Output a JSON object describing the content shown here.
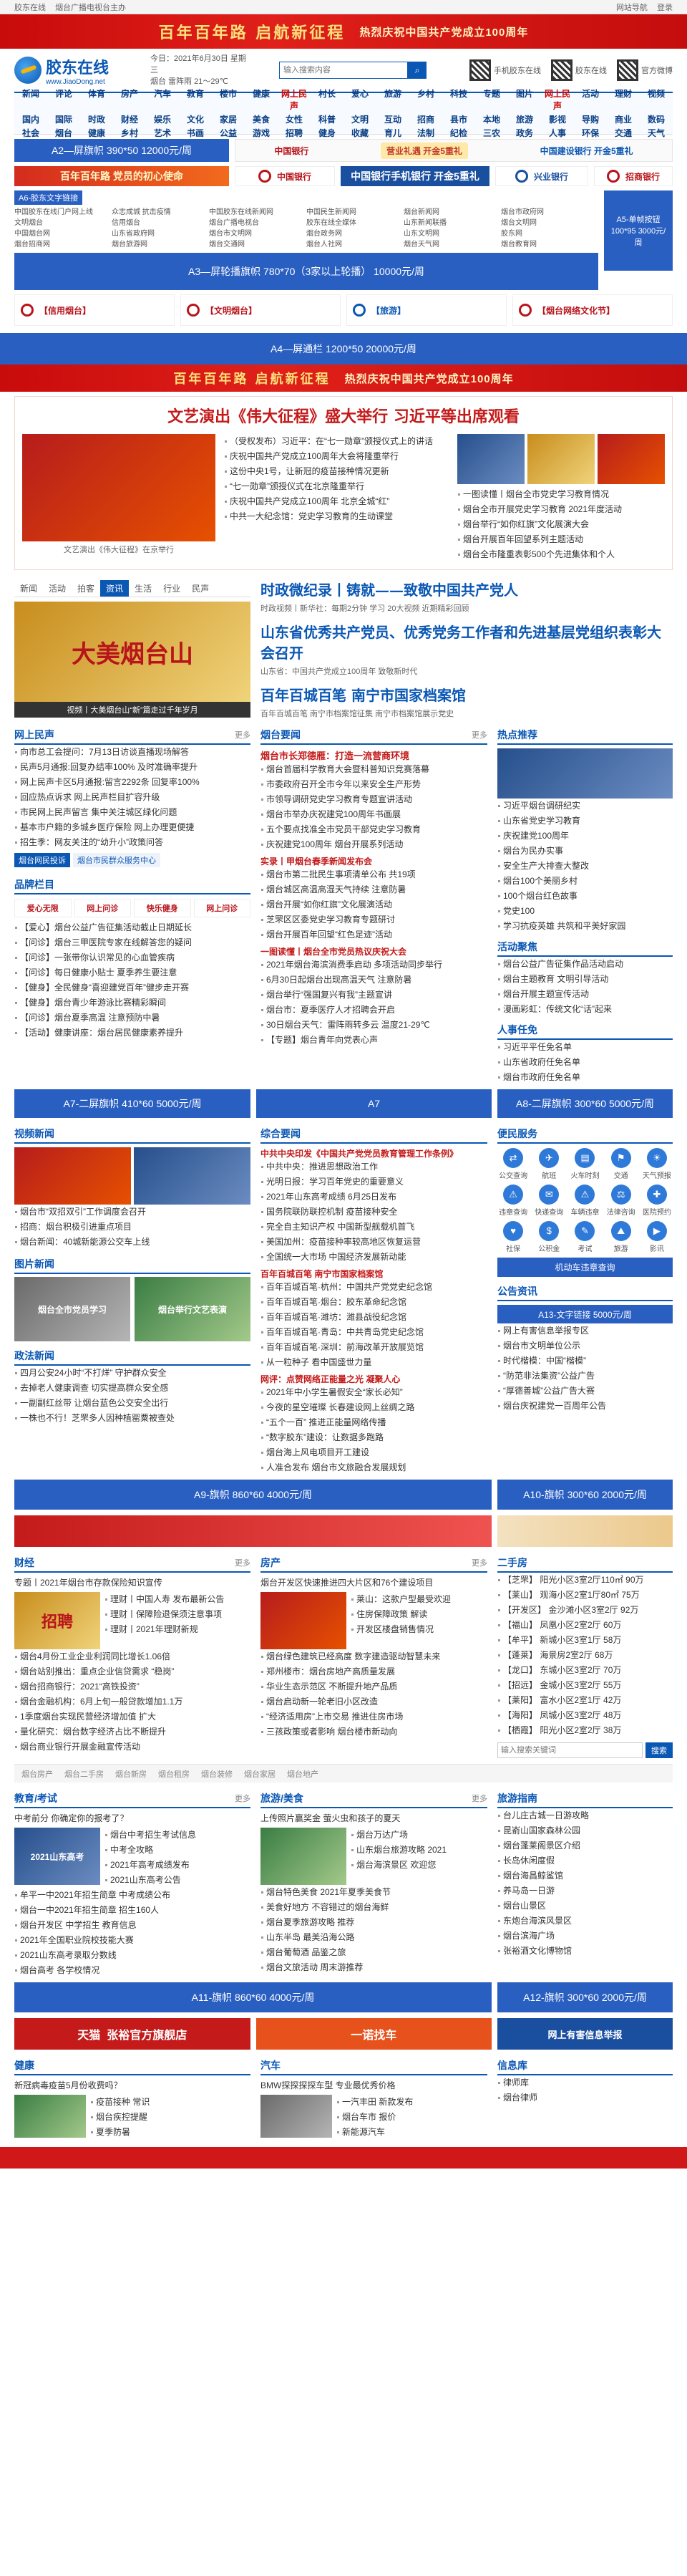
{
  "topbar": {
    "left": [
      "胶东在线",
      "烟台广播电视台主办"
    ],
    "right": [
      "网站导航",
      "登录"
    ]
  },
  "banner": {
    "main": "百年百年路 启航新征程",
    "sub": "热烈庆祝中国共产党成立100周年"
  },
  "header": {
    "logo_name": "胶东在线",
    "logo_url": "www.JiaoDong.net",
    "date": "今日：2021年6月30日 星期三",
    "weather": "烟台 雷阵雨 21～29℃",
    "search_placeholder": "输入搜索内容",
    "qr": [
      "手机胶东在线",
      "胶东在线",
      "官方微博"
    ]
  },
  "nav": [
    "新闻",
    "评论",
    "体育",
    "房产",
    "汽车",
    "教育",
    "楼市",
    "健康",
    "网上民声",
    "村长",
    "爱心",
    "旅游",
    "乡村",
    "科技",
    "专题",
    "图片",
    "网上民声",
    "活动",
    "理财",
    "视频",
    "国内",
    "国际",
    "时政",
    "财经",
    "娱乐",
    "文化",
    "家居",
    "美食",
    "女性",
    "科普",
    "文明",
    "互动",
    "招商",
    "县市",
    "本地",
    "旅游",
    "影视",
    "导购",
    "商业",
    "数码",
    "社会",
    "烟台",
    "健康",
    "乡村",
    "艺术",
    "书画",
    "公益",
    "游戏",
    "招聘",
    "健身",
    "收藏",
    "育儿",
    "法制",
    "纪检",
    "三农",
    "政务",
    "人事",
    "环保",
    "交通",
    "天气"
  ],
  "ads": {
    "a2": "A2—屏旗帜    390*50    12000元/周",
    "a3": "A3—屏轮播旗帜  780*70（3家以上轮播） 10000元/周",
    "a4": "A4—屏通栏    1200*50    20000元/周",
    "a5": "A5-单帧按钮 100*95 3000元/周",
    "a6": "A6-胶东文字链接",
    "a7_left": "A7-二屏旗帜  410*60  5000元/周",
    "a7_mid": "A7",
    "a8": "A8-二屏旗帜  300*60  5000元/周",
    "a9": "A9-旗帜  860*60  4000元/周",
    "a10": "A10-旗帜  300*60  2000元/周",
    "a11": "A11-旗帜  860*60  4000元/周",
    "a12": "A12-旗帜  300*60  2000元/周",
    "a13": "A13-文字链接  5000元/周",
    "bank1": "中国银行",
    "bank2": "中国银行手机银行 开金5重礼",
    "red_strip_1": "百年百年路 党员的初心使命",
    "red_strip_2": "热烈庆祝中国共产党成立100周年",
    "bank_promo": "中国建设银行 开金5重礼",
    "gift": "营业礼遇 开金5重礼",
    "cib": "兴业银行",
    "cmb": "招商银行",
    "yantai_1": "【信用烟台】",
    "yantai_2": "【文明烟台】",
    "yantai_3": "【旅游】",
    "yantai_4": "【烟台网络文化节】"
  },
  "text_links": [
    "中国胶东在线门户网上线",
    "众志成城 抗击疫情",
    "中国胶东在线新闻网",
    "中国民生新闻网",
    "烟台新闻网",
    "烟台市政府网",
    "文明烟台",
    "信用烟台",
    "烟台广播电视台",
    "胶东在线全媒体",
    "山东新闻联播",
    "烟台文明网",
    "中国烟台网",
    "山东省政府网",
    "烟台市文明网",
    "烟台政务网",
    "山东文明网",
    "胶东网",
    "烟台招商网",
    "烟台旅游网",
    "烟台交通网",
    "烟台人社网",
    "烟台天气网",
    "烟台教育网"
  ],
  "feature": {
    "headline": "文艺演出《伟大征程》盛大举行 习近平等出席观看",
    "items": [
      "（受权发布）习近平：在“七一勋章”颁授仪式上的讲话",
      "庆祝中国共产党成立100周年大会将隆重举行",
      "这份中央1号，让新冠的疫苗接种情况更新",
      "“七一勋章”颁授仪式在北京隆重举行",
      "庆祝中国共产党成立100周年 北京全城“红”",
      "中共一大纪念馆：党史学习教育的生动课堂"
    ],
    "right_items": [
      "一图读懂丨烟台全市党史学习教育情况",
      "烟台全市开展党史学习教育 2021年度活动",
      "烟台举行“如你红旗”文化展演大会",
      "烟台开展百年回望系列主题活动",
      "烟台全市隆重表彰500个先进集体和个人"
    ],
    "img_caption": "文艺演出《伟大征程》在京举行"
  },
  "section_tabs": [
    "新闻",
    "活动",
    "拍客",
    "资讯",
    "生活",
    "行业",
    "民声"
  ],
  "fancy_title": "大美烟台山",
  "fancy_caption": "视频丨大美烟台山“新”篇走过千年岁月",
  "politics": {
    "title": "时政微纪录丨铸就——致敬中国共产党人",
    "sub": "时政视频丨新华社：每期2分钟 学习 20大视频 近期精彩回顾",
    "headline2": "山东省优秀共产党员、优秀党务工作者和先进基层党组织表彰大会召开",
    "sub2": "山东省：中国共产党成立100周年 致敬新时代",
    "headline3": "百年百城百笔  南宁市国家档案馆",
    "sub3": "百年百城百笔 南宁市档案馆征集 南宁市档案馆展示党史"
  },
  "minsheng": {
    "title": "网上民声",
    "more": "更多",
    "items": [
      "向市总工会提问：7月13日访谈直播现场解答",
      "民声5月通报:回复办结率100% 及时准确率提升",
      "网上民声卡区5月通报:留言2292条 回复率100%",
      "回应热点诉求 网上民声栏目扩容升级",
      "市民网上民声留言 集中关注城区绿化问题",
      "基本市户籍的多城乡医疗保险 网上办理更便捷",
      "招生季：网友关注的“幼升小”政策问答"
    ],
    "tabs": [
      "烟台网民投诉",
      "烟台市民群众服务中心"
    ]
  },
  "brand": {
    "title": "品牌栏目",
    "logos": [
      "爱心无限",
      "网上问诊",
      "快乐健身",
      "网上问诊"
    ],
    "items": [
      "【爱心】烟台公益广告征集活动截止日期延长",
      "【问诊】烟台三甲医院专家在线解答您的疑问",
      "【问诊】一张带你认识常见的心血管疾病",
      "【问诊】每日健康小贴士 夏季养生要注意",
      "【健身】全民健身“喜迎建党百年”健步走开赛",
      "【健身】烟台青少年游泳比赛精彩瞬间",
      "【问诊】烟台夏季高温 注意预防中暑",
      "【活动】健康讲座：烟台居民健康素养提升"
    ]
  },
  "yantai_news": {
    "title": "烟台要闻",
    "more": "更多",
    "top": "烟台市长郑德雁：打造一流营商环境",
    "list_a": [
      "烟台首届科学教育大会暨科普知识竞赛落幕",
      "市委政府召开全市今年以来安全生产形势",
      "市领导调研党史学习教育专题宣讲活动",
      "烟台市举办庆祝建党100周年书画展",
      "五个要点找准全市党员干部党史学习教育",
      "庆祝建党100周年 烟台开展系列活动"
    ],
    "group1_title": "实录丨甲烟台春季新闻发布会",
    "list_b": [
      "烟台市第二批民生事项清单公布 共19项",
      "烟台城区高温高湿天气持续 注意防暑",
      "烟台开展“如你红旗”文化展演活动",
      "芝罘区区委党史学习教育专题研讨",
      "烟台开展百年回望“红色足迹”活动"
    ],
    "group2_title": "一图读懂丨烟台全市党员热议庆祝大会",
    "list_c": [
      "2021年烟台海滨消费季启动 多项活动同步举行",
      "6月30日起烟台出现高温天气 注意防暑",
      "烟台举行“强国复兴有我”主题宣讲",
      "烟台市：夏季医疗人才招聘会开启",
      "30日烟台天气：雷阵雨转多云 温度21-29℃",
      "【专题】烟台青年向党表心声"
    ]
  },
  "hot": {
    "title": "热点推荐",
    "items": [
      "习近平烟台调研纪实",
      "山东省党史学习教育",
      "庆祝建党100周年",
      "烟台为民办实事",
      "安全生产大排查大整改",
      "烟台100个美丽乡村",
      "100个烟台红色故事",
      "党史100",
      "学习抗疫英雄 共筑和平美好家园"
    ],
    "activity_title": "活动聚焦",
    "activity": [
      "烟台公益广告征集作品活动启动",
      "烟台主题教育 文明引导活动",
      "烟台开展主题宣传活动",
      "漫画彩虹：传统文化“话”起来"
    ],
    "people_title": "人事任免",
    "people": [
      "习近平平任免名单",
      "山东省政府任免名单",
      "烟台市政府任免名单"
    ]
  },
  "video": {
    "title": "视频新闻",
    "items": [
      "烟台市“双招双引”工作调度会召开",
      "招商：烟台积极引进重点项目",
      "烟台新闻：40城新能源公交车上线"
    ]
  },
  "pictures": {
    "title": "图片新闻",
    "caption1": "烟台全市党员学习",
    "caption2": "烟台举行文艺表演"
  },
  "politics_news": {
    "title": "政法新闻",
    "items": [
      "四月公安24小时“不打烊” 守护群众安全",
      "去掉老人健康调查 切实提高群众安全感",
      "一副副红丝带 让烟台蓝色公交安全出行",
      "一株也不行！芝罘多人因种植罂粟被查处"
    ]
  },
  "general": {
    "title": "综合要闻",
    "top": "中共中央印发《中国共产党党员教育管理工作条例》",
    "items": [
      "中共中央：推进思想政治工作",
      "光明日报：学习百年党史的重要意义",
      "2021年山东高考成绩 6月25日发布",
      "国务院联防联控机制 疫苗接种安全",
      "完全自主知识产权 中国新型舰载机首飞",
      "美国加州：疫苗接种率较高地区恢复运营",
      "全国统一大市场 中国经济发展新动能"
    ],
    "sub_title": "百年百城百笔 南宁市国家档案馆",
    "items2": [
      "百年百城百笔·杭州：中国共产党党史纪念馆",
      "百年百城百笔·烟台：胶东革命纪念馆",
      "百年百城百笔·潍坊：潍县战役纪念馆",
      "百年百城百笔·青岛：中共青岛党史纪念馆",
      "百年百城百笔·深圳：前海改革开放展览馆",
      "从一粒种子 看中国盛世力量"
    ],
    "sub2_title": "网评：点赞网络正能量之光 凝聚人心",
    "items3": [
      "2021年中小学生暑假安全“家长必知”",
      "今夜的星空璀璨 长春建设网上丝绸之路",
      "“五个一百” 推进正能量网络传播",
      "“数字胶东”建设：让数据多跑路",
      "烟台海上风电项目开工建设",
      "人准合发布 烟台市文旅融合发展规划"
    ]
  },
  "service": {
    "title": "便民服务",
    "items": [
      "公交查询",
      "航班",
      "火车时刻",
      "交通",
      "天气预报",
      "违章查询",
      "快递查询",
      "车辆违章",
      "法律咨询",
      "医院预约",
      "社保",
      "公积金",
      "考试",
      "旅游",
      "影讯"
    ],
    "car_btn": "机动车违章查询"
  },
  "notice": {
    "title": "公告资讯",
    "items": [
      "网上有害信息举报专区",
      "烟台市文明单位公示",
      "时代楷模：中国“楷模”",
      "“防范非法集资”公益广告",
      "“厚德善城”公益广告大赛",
      "烟台庆祝建党一百周年公告"
    ]
  },
  "finance": {
    "title": "财经",
    "more": "更多",
    "special": "专题丨2021年烟台市存款保险知识宣传",
    "img1": "招聘",
    "items_side": [
      "理财丨中国人寿 发布最新公告",
      "理财丨保障险退保须注意事项",
      "理财丨2021年理财新规"
    ],
    "items": [
      "烟台4月份工业企业利润同比增长1.06倍",
      "烟台站别推出：重点企业信贷需求 “稳岗”",
      "烟台招商银行：2021“高铁投资”",
      "烟台金融机构：6月上旬一般贷款增加1.1万",
      "1季度烟台实现民营经济增加值 扩大",
      "量化研究：烟台数字经济占比不断提升",
      "烟台商业银行开展金融宣传活动"
    ]
  },
  "house": {
    "title": "房产",
    "more": "更多",
    "special": "烟台开发区快速推进四大片区和76个建设项目",
    "items_side": [
      "莱山：这款户型最受欢迎",
      "住房保障政策 解读",
      "开发区楼盘销售情况"
    ],
    "items": [
      "烟台绿色建筑已经高度 数字建造驱动智慧未来",
      "郑州楼市：烟台房地产高质量发展",
      "华业生态示范区 不断提升地产品质",
      "烟台启动新一轮老旧小区改造",
      "“经济适用房”上市交易 推进住房市场",
      "三孩政策或者影响 烟台楼市新动向"
    ]
  },
  "second_hand": {
    "title": "二手房",
    "items": [
      "【芝罘】 阳光小区3室2厅110㎡ 90万",
      "【莱山】 观海小区2室1厅80㎡ 75万",
      "【开发区】 金沙滩小区3室2厅 92万",
      "【福山】 凤凰小区2室2厅 60万",
      "【牟平】 新城小区3室1厅 58万",
      "【蓬莱】 海景房2室2厅 68万",
      "【龙口】 东城小区3室2厅 70万",
      "【招远】 金城小区3室2厅 55万",
      "【莱阳】 富水小区2室1厅 42万",
      "【海阳】 凤城小区3室2厅 48万",
      "【栖霞】 阳光小区2室2厅 38万"
    ],
    "search_placeholder": "输入搜索关键词",
    "search_btn": "搜索"
  },
  "footer_links": [
    "烟台房产",
    "烟台二手房",
    "烟台新房",
    "烟台租房",
    "烟台装修",
    "烟台家居",
    "烟台地产"
  ],
  "education": {
    "title": "教育/考试",
    "more": "更多",
    "top": "中考前分 你确定你的报考了？",
    "img": "2021山东高考",
    "items": [
      "烟台中考招生考试信息",
      "中考全攻略",
      "2021年高考成绩发布",
      "2021山东高考公告"
    ],
    "items2": [
      "牟平一中2021年招生简章 中考成绩公布",
      "烟台一中2021年招生简章 招生160人",
      "烟台开发区 中学招生 教育信息",
      "2021年全国职业院校技能大赛",
      "2021山东高考录取分数线",
      "烟台高考 各学校情况"
    ]
  },
  "travel": {
    "title": "旅游/美食",
    "more": "更多",
    "top": "上传照片赢奖金 萤火虫和孩子的夏天",
    "items": [
      "烟台万达广场",
      "山东烟台旅游攻略 2021",
      "烟台海滨景区 欢迎您"
    ],
    "items2": [
      "烟台特色美食 2021年夏季美食节",
      "美食好地方 不容错过的烟台海鲜",
      "烟台夏季旅游攻略 推荐",
      "山东半岛 最美沿海公路",
      "烟台葡萄酒 品鉴之旅",
      "烟台文旅活动 周末游推荐"
    ]
  },
  "guide": {
    "title": "旅游指南",
    "items": [
      "台儿庄古城一日游攻略",
      "昆嵛山国家森林公园",
      "烟台蓬莱阁景区介绍",
      "长岛休闲度假",
      "烟台海昌鲸鲨馆",
      "养马岛一日游",
      "烟台山景区",
      "东炮台海滨风景区",
      "烟台滨海广场",
      "张裕酒文化博物馆"
    ]
  },
  "promo_bottom": [
    "天猫",
    "张裕官方旗舰店",
    "一诺找车",
    "网上有害信息举报"
  ],
  "health": {
    "title": "健康",
    "top": "新冠病毒疫苗5月份收费吗？",
    "items": [
      "疫苗接种 常识",
      "烟台疾控提醒",
      "夏季防暑"
    ]
  },
  "auto": {
    "title": "汽车",
    "top": "BMW探探探探车型 专业最优秀价格",
    "items": [
      "一汽丰田 新款发布",
      "烟台车市 报价",
      "新能源汽车"
    ]
  },
  "info": {
    "title": "信息库",
    "items": [
      "律师库",
      "烟台律师"
    ]
  }
}
